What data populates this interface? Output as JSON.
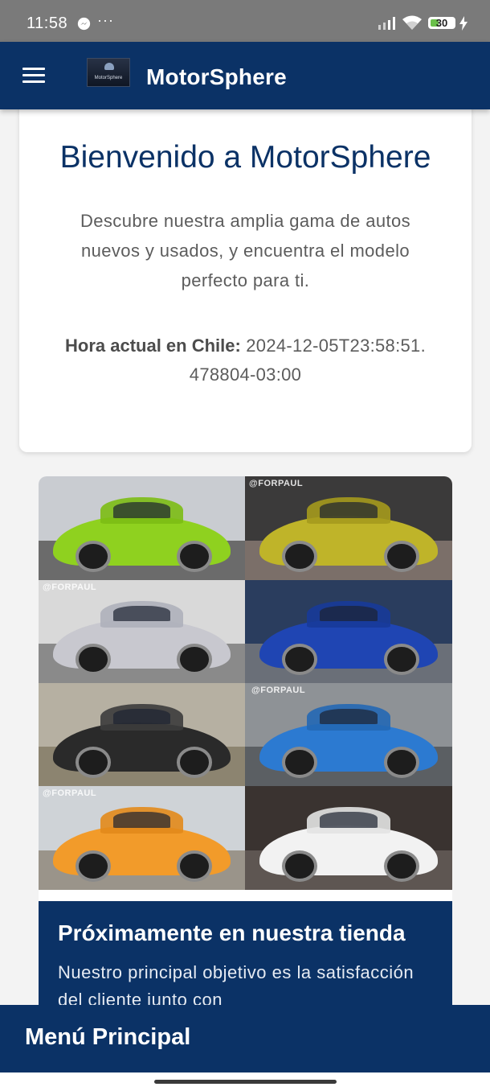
{
  "status_bar": {
    "time": "11:58",
    "more": "···",
    "battery_level": "30",
    "icons": [
      "messenger-icon",
      "signal-icon",
      "wifi-icon",
      "battery-icon",
      "charging-icon"
    ]
  },
  "header": {
    "menu_icon": "hamburger-menu-icon",
    "logo_text": "MotorSphere",
    "title": "MotorSphere",
    "background": "#0b3266"
  },
  "welcome": {
    "heading": "Bienvenido a MotorSphere",
    "description": "Descubre nuestra amplia gama de autos nuevos y usados, y encuentra el modelo perfecto para ti.",
    "time_label": "Hora actual en Chile:",
    "time_value": "2024-12-05T23:58:51.478804-03:00"
  },
  "product": {
    "image_watermark": "@FORPAUL",
    "heading": "Próximamente en nuestra tienda",
    "text": "Nuestro principal objetivo es la satisfacción del cliente junto con"
  },
  "bottom_menu": {
    "label": "Menú Principal"
  },
  "colors": {
    "brand": "#0b3266",
    "status_bar": "#7a7a7a",
    "page_bg": "#f3f3f3"
  }
}
